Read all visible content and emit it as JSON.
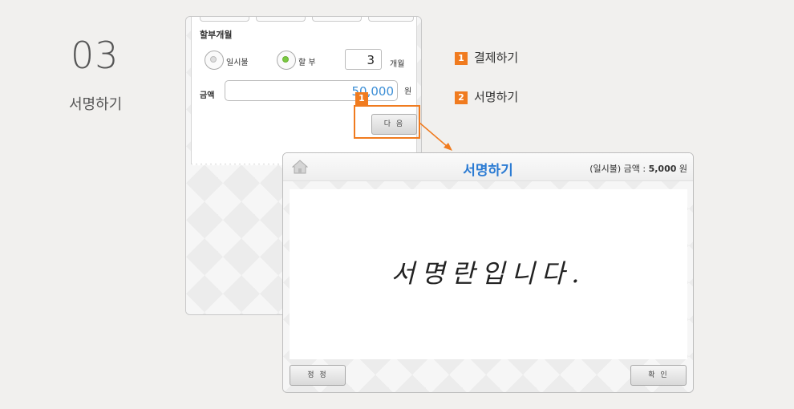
{
  "step": {
    "number": "03",
    "title": "서명하기"
  },
  "payment_form": {
    "installment_label": "할부개월",
    "lump_sum_label": "일시불",
    "installment_option_label": "할 부",
    "months_value": "3",
    "months_unit": "개월",
    "amount_label": "금액",
    "amount_value": "50,000",
    "amount_unit": "원",
    "next_button": "다 음",
    "selected_option": "installment"
  },
  "callouts": {
    "badge_1": "1",
    "badge_2": "2",
    "step_1_label": "결제하기",
    "step_2_label": "서명하기",
    "accent_color": "#f07b1f"
  },
  "signature_screen": {
    "title": "서명하기",
    "info_prefix": "(일시불)  금액 : ",
    "info_amount": "5,000",
    "info_unit": " 원",
    "signature_text": "서명란입니다.",
    "clear_button": "정 정",
    "confirm_button": "확 인",
    "title_color": "#2b7bd3"
  },
  "icons": {
    "home": "home-icon"
  }
}
